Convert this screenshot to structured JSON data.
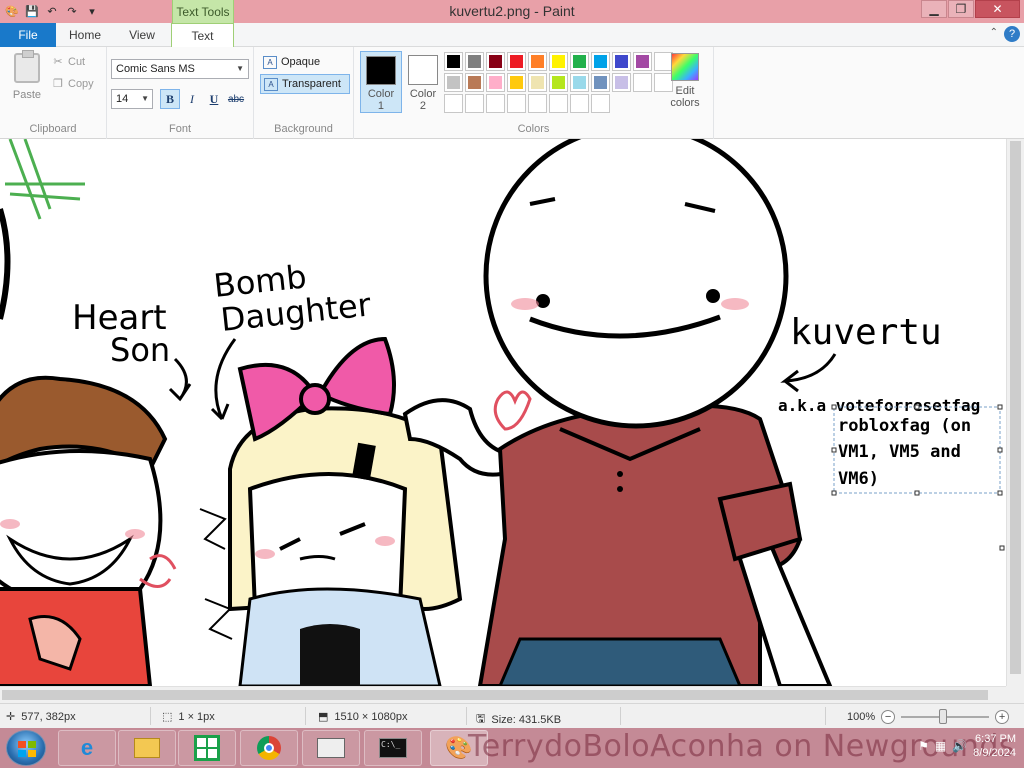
{
  "window": {
    "title": "kuvertu2.png - Paint",
    "context_tab_header": "Text Tools",
    "controls": {
      "minimize": "▁",
      "maximize": "❐",
      "close": "✕"
    }
  },
  "tabs": {
    "file": "File",
    "home": "Home",
    "view": "View",
    "text": "Text",
    "help": "?"
  },
  "ribbon": {
    "clipboard": {
      "label": "Clipboard",
      "paste": "Paste",
      "cut": "Cut",
      "copy": "Copy"
    },
    "font": {
      "label": "Font",
      "family": "Comic Sans MS",
      "size": "14",
      "bold": "B",
      "italic": "I",
      "underline": "U",
      "strike": "abc"
    },
    "background": {
      "label": "Background",
      "opaque": "Opaque",
      "transparent": "Transparent"
    },
    "colors": {
      "label": "Colors",
      "color1_label": "Color\n1",
      "color2_label": "Color\n2",
      "color1": "#000000",
      "color2": "#ffffff",
      "edit_colors": "Edit colors",
      "palette": [
        "#000000",
        "#7f7f7f",
        "#880015",
        "#ed1c24",
        "#ff7f27",
        "#fff200",
        "#22b14c",
        "#00a2e8",
        "#3f48cc",
        "#a349a4",
        "#ffffff",
        "#c3c3c3",
        "#b97a57",
        "#ffaec9",
        "#ffc90e",
        "#efe4b0",
        "#b5e61d",
        "#99d9ea",
        "#7092be",
        "#c8bfe7",
        "#ffffff",
        "#ffffff",
        "#ffffff",
        "#ffffff",
        "#ffffff",
        "#ffffff",
        "#ffffff",
        "#ffffff",
        "#ffffff",
        "#ffffff"
      ]
    }
  },
  "canvas": {
    "labels": {
      "heart_son": [
        "Heart",
        "Son"
      ],
      "bomb_daughter": [
        "Bomb",
        "Daughter"
      ],
      "kuvertu": "kuvertu",
      "aka": "a.k.a voteforresetfag",
      "textbox_lines": [
        "robloxfag (on",
        "VM1, VM5 and",
        "VM6)"
      ]
    }
  },
  "status": {
    "cursor_pos": "577, 382px",
    "selection": "1 × 1px",
    "image_size": "1510 × 1080px",
    "file_size": "Size: 431.5KB",
    "zoom": "100%"
  },
  "taskbar": {
    "watermark": "TerrydoBoloAconha on Newgrounds",
    "time": "6:37 PM",
    "date": "8/9/2024"
  }
}
